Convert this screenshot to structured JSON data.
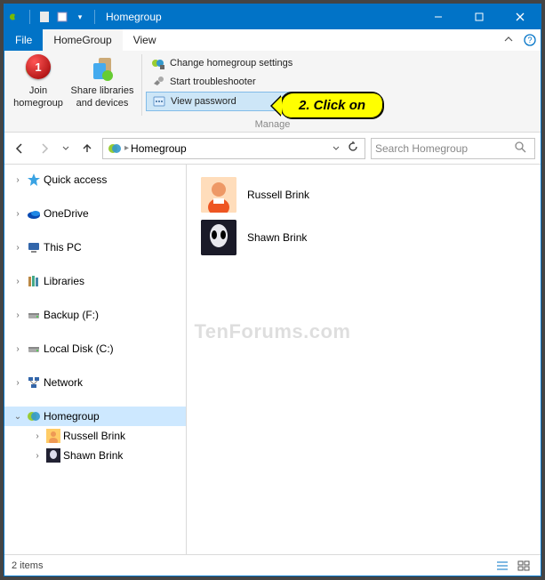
{
  "title": "Homegroup",
  "tabs": {
    "file": "File",
    "homegroup": "HomeGroup",
    "view": "View"
  },
  "ribbon": {
    "join": "Join\nhomegroup",
    "share": "Share libraries\nand devices",
    "change_settings": "Change homegroup settings",
    "start_troubleshooter": "Start troubleshooter",
    "view_password": "View password",
    "group_label": "Manage"
  },
  "address": {
    "location": "Homegroup",
    "search_placeholder": "Search Homegroup"
  },
  "sidebar": {
    "quick_access": "Quick access",
    "onedrive": "OneDrive",
    "this_pc": "This PC",
    "libraries": "Libraries",
    "backup": "Backup (F:)",
    "local_disk": "Local Disk (C:)",
    "network": "Network",
    "homegroup": "Homegroup",
    "russell": "Russell Brink",
    "shawn": "Shawn Brink"
  },
  "content": {
    "items": [
      {
        "name": "Russell Brink"
      },
      {
        "name": "Shawn Brink"
      }
    ]
  },
  "status": {
    "count": "2 items"
  },
  "annotations": {
    "num1": "1",
    "callout": "2. Click on"
  },
  "watermark": "TenForums.com"
}
